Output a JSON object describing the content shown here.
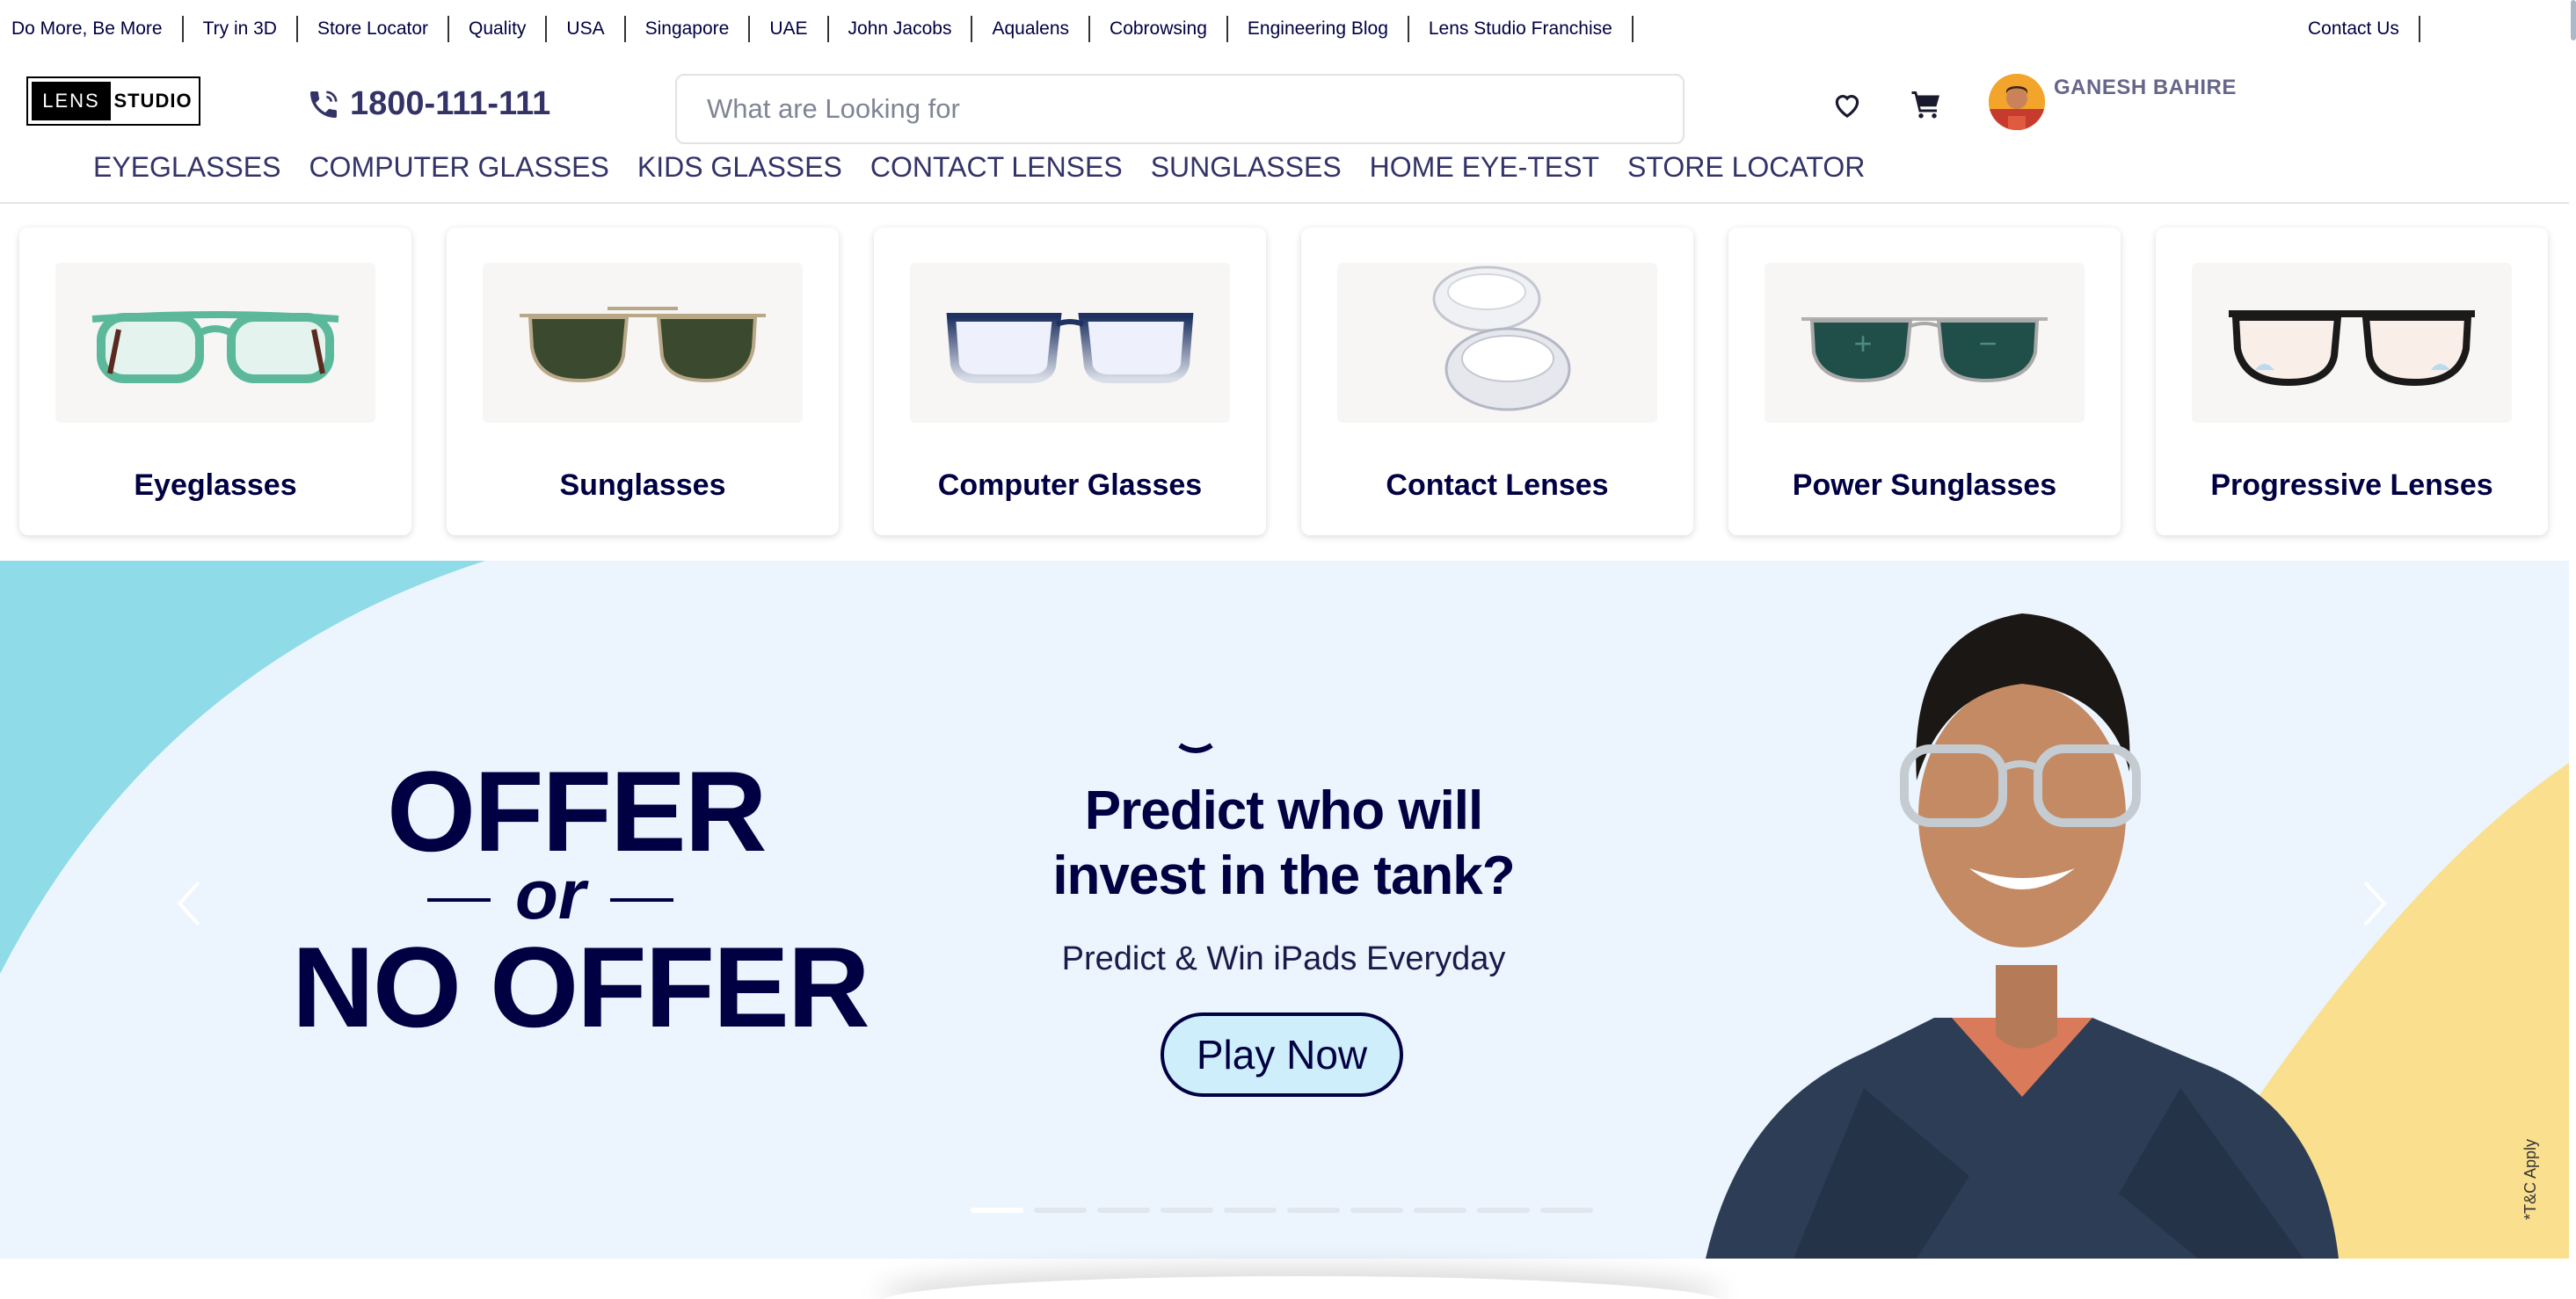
{
  "top_links": [
    "Do More, Be More",
    "Try in 3D",
    "Store Locator",
    "Quality",
    "USA",
    "Singapore",
    "UAE",
    "John Jacobs",
    "Aqualens",
    "Cobrowsing",
    "Engineering Blog",
    "Lens Studio Franchise"
  ],
  "contact_link": "Contact Us",
  "logo": {
    "left": "LENS",
    "right": "STUDIO"
  },
  "phone": "1800-111-111",
  "search": {
    "placeholder": "What are Looking for"
  },
  "user": {
    "name": "GANESH BAHIRE"
  },
  "nav": [
    "EYEGLASSES",
    "COMPUTER GLASSES",
    "KIDS GLASSES",
    "CONTACT LENSES",
    "SUNGLASSES",
    "HOME EYE-TEST",
    "STORE LOCATOR"
  ],
  "categories": [
    {
      "label": "Eyeglasses",
      "icon": "green-eyeglasses-image"
    },
    {
      "label": "Sunglasses",
      "icon": "aviator-sunglasses-image"
    },
    {
      "label": "Computer Glasses",
      "icon": "computer-glasses-image"
    },
    {
      "label": "Contact Lenses",
      "icon": "contact-lenses-image"
    },
    {
      "label": "Power Sunglasses",
      "icon": "power-sunglasses-image"
    },
    {
      "label": "Progressive Lenses",
      "icon": "progressive-lenses-image"
    }
  ],
  "banner": {
    "offer_line1": "OFFER",
    "offer_or": "or",
    "offer_line2": "NO OFFER",
    "headline": "Predict who will invest in the tank?",
    "subheadline": "Predict & Win iPads Everyday",
    "cta": "Play Now",
    "tc": "*T&C Apply",
    "slide_count": 10,
    "active_slide": 1
  },
  "colors": {
    "brand": "#000042",
    "banner_bg": "#ecf5fd",
    "accent_cyan": "#8fdbe8",
    "accent_yellow": "#f9df8e"
  }
}
